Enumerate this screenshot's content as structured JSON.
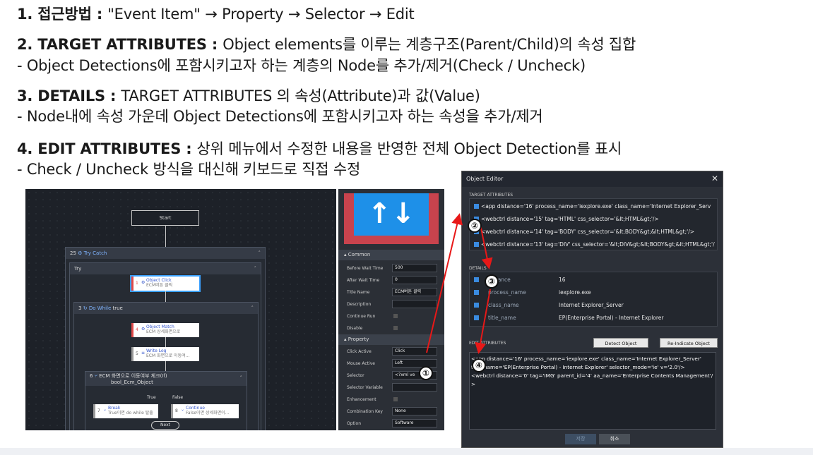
{
  "instructions": {
    "l1_head": "1.  접근방법 : ",
    "l1_body": "\"Event Item\" → Property → Selector → Edit",
    "l2_head": "2.  TARGET ATTRIBUTES : ",
    "l2_body": "Object elements를 이루는 계층구조(Parent/Child)의 속성 집합",
    "l2_sub": "- Object Detections에 포함시키고자 하는 계층의 Node를 추가/제거(Check / Uncheck)",
    "l3_head": "3.  DETAILS : ",
    "l3_body": "TARGET ATTRIBUTES 의 속성(Attribute)과 값(Value)",
    "l3_sub": "- Node내에 속성 가운데 Object Detections에 포함시키고자 하는 속성을 추가/제거",
    "l4_head": "4.  EDIT ATTRIBUTES : ",
    "l4_body": "상위 메뉴에서 수정한 내용을 반영한 전체 Object Detection를 표시",
    "l4_sub": "- Check / Uncheck 방식을 대신해 키보드로 직접 수정"
  },
  "workflow": {
    "start": "Start",
    "try_catch": "Try Catch",
    "try_catch_num": "25",
    "try": "Try",
    "object_click": "Object Click",
    "object_click_desc": "ECM버튼 클릭",
    "do_while_num": "3",
    "do_while": "Do While",
    "do_while_cond": "true",
    "object_match": "Object Match",
    "object_match_desc": "ECM 상세화면으로",
    "write_log": "Write Log",
    "write_log_desc": "ECM 화면으로 이동여...",
    "if_num": "6",
    "if_title": "ECM 화면으로 이동여부 체크(If)",
    "if_var": "bool_Ecm_Object",
    "true_label": "True",
    "false_label": "False",
    "break": "Break",
    "break_desc": "True이면 do while 탈출",
    "break_num": "7",
    "continue": "Continue",
    "continue_desc": "False이면 상세화면이...",
    "continue_num": "8",
    "next": "Next",
    "n1": "1",
    "n4": "4",
    "n5": "5"
  },
  "properties": {
    "common": "Common",
    "before_wait_label": "Before Wait Time",
    "before_wait_value": "500",
    "after_wait_label": "After Wait Time",
    "after_wait_value": "0",
    "title_label": "Title Name",
    "title_value": "ECM버튼 클릭",
    "description_label": "Description",
    "continue_run_label": "Continue Run",
    "disable_label": "Disable",
    "property": "Property",
    "click_active_label": "Click Active",
    "click_active_value": "Click",
    "mouse_active_label": "Mouse Active",
    "mouse_active_value": "Left",
    "selector_label": "Selector",
    "selector_value": "<?xml ve",
    "selector_variable_label": "Selector Variable",
    "enhancement_label": "Enhancement",
    "combination_key_label": "Combination Key",
    "combination_key_value": "None",
    "option_label": "Option",
    "option_value": "Software"
  },
  "object_editor": {
    "title": "Object Editor",
    "target_attributes": "TARGET ATTRIBUTES",
    "targets": [
      "<app distance='16' process_name='iexplore.exe' class_name='Internet Explorer_Serv",
      "<webctrl distance='15' tag='HTML' css_selector='&lt;HTML&gt;'/>",
      "<webctrl distance='14' tag='BODY' css_selector='&lt;BODY&gt;&lt;HTML&gt;'/>",
      "<webctrl distance='13' tag='DIV' css_selector='&lt;DIV&gt;&lt;BODY&gt;&lt;HTML&gt;'/"
    ],
    "details": "DETAILS",
    "detail_rows": [
      {
        "key": "distance",
        "value": "16"
      },
      {
        "key": "process_name",
        "value": "iexplore.exe"
      },
      {
        "key": "class_name",
        "value": "Internet Explorer_Server"
      },
      {
        "key": "title_name",
        "value": "EP(Enterprise Portal) - Internet Explorer"
      }
    ],
    "edit_attributes": "EDIT ATTRIBUTES",
    "detect_object": "Detect Object",
    "reindicate_object": "Re-Indicate Object",
    "edit_lines": [
      "<app distance='16' process_name='iexplore.exe' class_name='Internet Explorer_Server'",
      "title_name='EP(Enterprise Portal) - Internet Explorer' selector_mode='ie' v='2.0'/>",
      "<webctrl distance='0' tag='IMG' parent_id='4' aa_name='Enterprise Contents Management'/",
      ">"
    ],
    "ok": "저장",
    "cancel": "취소"
  },
  "markers": {
    "m1": "①",
    "m2": "②",
    "m3": "③",
    "m4": "④"
  },
  "colors": {
    "accent": "#3a8be0",
    "arrow": "#e81818",
    "dark_bg": "#1d2128"
  }
}
